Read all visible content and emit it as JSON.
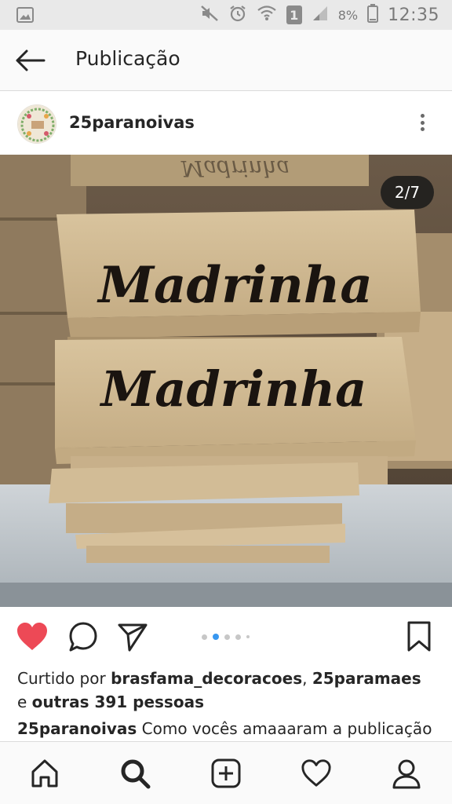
{
  "status_bar": {
    "time": "12:35",
    "battery_percent": "8%",
    "sim_badge": "1",
    "icons": [
      "image-notification-icon",
      "mute-icon",
      "alarm-icon",
      "wifi-icon",
      "sim-icon",
      "signal-icon",
      "battery-icon"
    ]
  },
  "app_bar": {
    "title": "Publicação",
    "back_icon": "arrow-left-icon"
  },
  "post": {
    "username": "25paranoivas",
    "more_icon": "more-vertical-icon",
    "photo": {
      "counter": "2/7",
      "box_text_top": "Madrinha",
      "box_text_bottom": "Madrinha"
    },
    "actions": {
      "like_icon": "heart-icon",
      "liked": true,
      "comment_icon": "comment-icon",
      "share_icon": "send-icon",
      "save_icon": "bookmark-icon",
      "carousel_total_dots": 5,
      "carousel_active_index": 1
    },
    "likes": {
      "prefix": "Curtido por",
      "user1": "brasfama_decoracoes",
      "separator": ",",
      "user2": "25paramaes",
      "line2_prefix": "e",
      "others": "outras 391 pessoas"
    },
    "caption": {
      "username": "25paranoivas",
      "text": "Como vocês amaaaram a publicação"
    }
  },
  "bottom_nav": {
    "items": [
      "home-icon",
      "search-icon",
      "add-icon",
      "activity-icon",
      "profile-icon"
    ],
    "active": "search-icon"
  },
  "colors": {
    "like_red": "#ed4956",
    "carousel_blue": "#3897f0",
    "text": "#262626",
    "divider": "#dbdbdb"
  }
}
